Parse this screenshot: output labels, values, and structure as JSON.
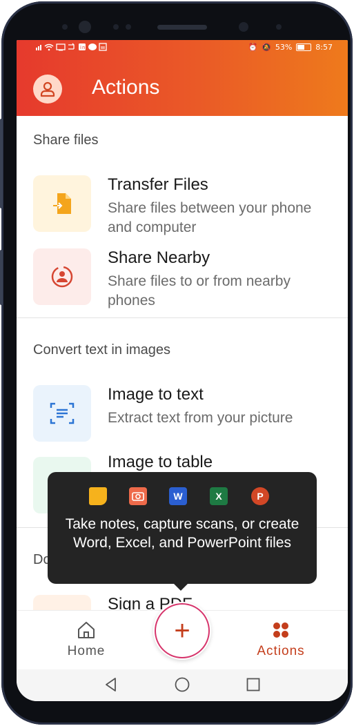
{
  "status_bar": {
    "left_icons": "signal wifi cast sync linkedin chat gallery",
    "battery_percent": "53%",
    "time": "8:57"
  },
  "header": {
    "title": "Actions",
    "avatar_icon": "person-icon"
  },
  "sections": [
    {
      "title": "Share files",
      "items": [
        {
          "title": "Transfer Files",
          "description": "Share files between your phone and computer",
          "icon": "transfer-icon"
        },
        {
          "title": "Share Nearby",
          "description": "Share files to or from nearby phones",
          "icon": "nearby-icon"
        }
      ]
    },
    {
      "title": "Convert text in images",
      "items": [
        {
          "title": "Image to text",
          "description": "Extract text from your picture",
          "icon": "text-scan-icon"
        },
        {
          "title": "Image to table",
          "description": "",
          "icon": "table-scan-icon"
        }
      ]
    },
    {
      "title": "Do",
      "items": [
        {
          "title": "Sign a PDF",
          "description": "",
          "icon": "sign-icon"
        }
      ]
    }
  ],
  "tooltip": {
    "text": "Take notes, capture scans, or create Word, Excel, and PowerPoint files",
    "apps": [
      "Notes",
      "Scan",
      "W",
      "X",
      "P"
    ]
  },
  "bottom_nav": {
    "home_label": "Home",
    "actions_label": "Actions",
    "fab_symbol": "+"
  },
  "colors": {
    "accent": "#c43e1c",
    "header_start": "#e63a2d",
    "header_end": "#ee7a1c",
    "word": "#2b5fd1",
    "excel": "#1e7a43",
    "powerpoint": "#d24726"
  }
}
